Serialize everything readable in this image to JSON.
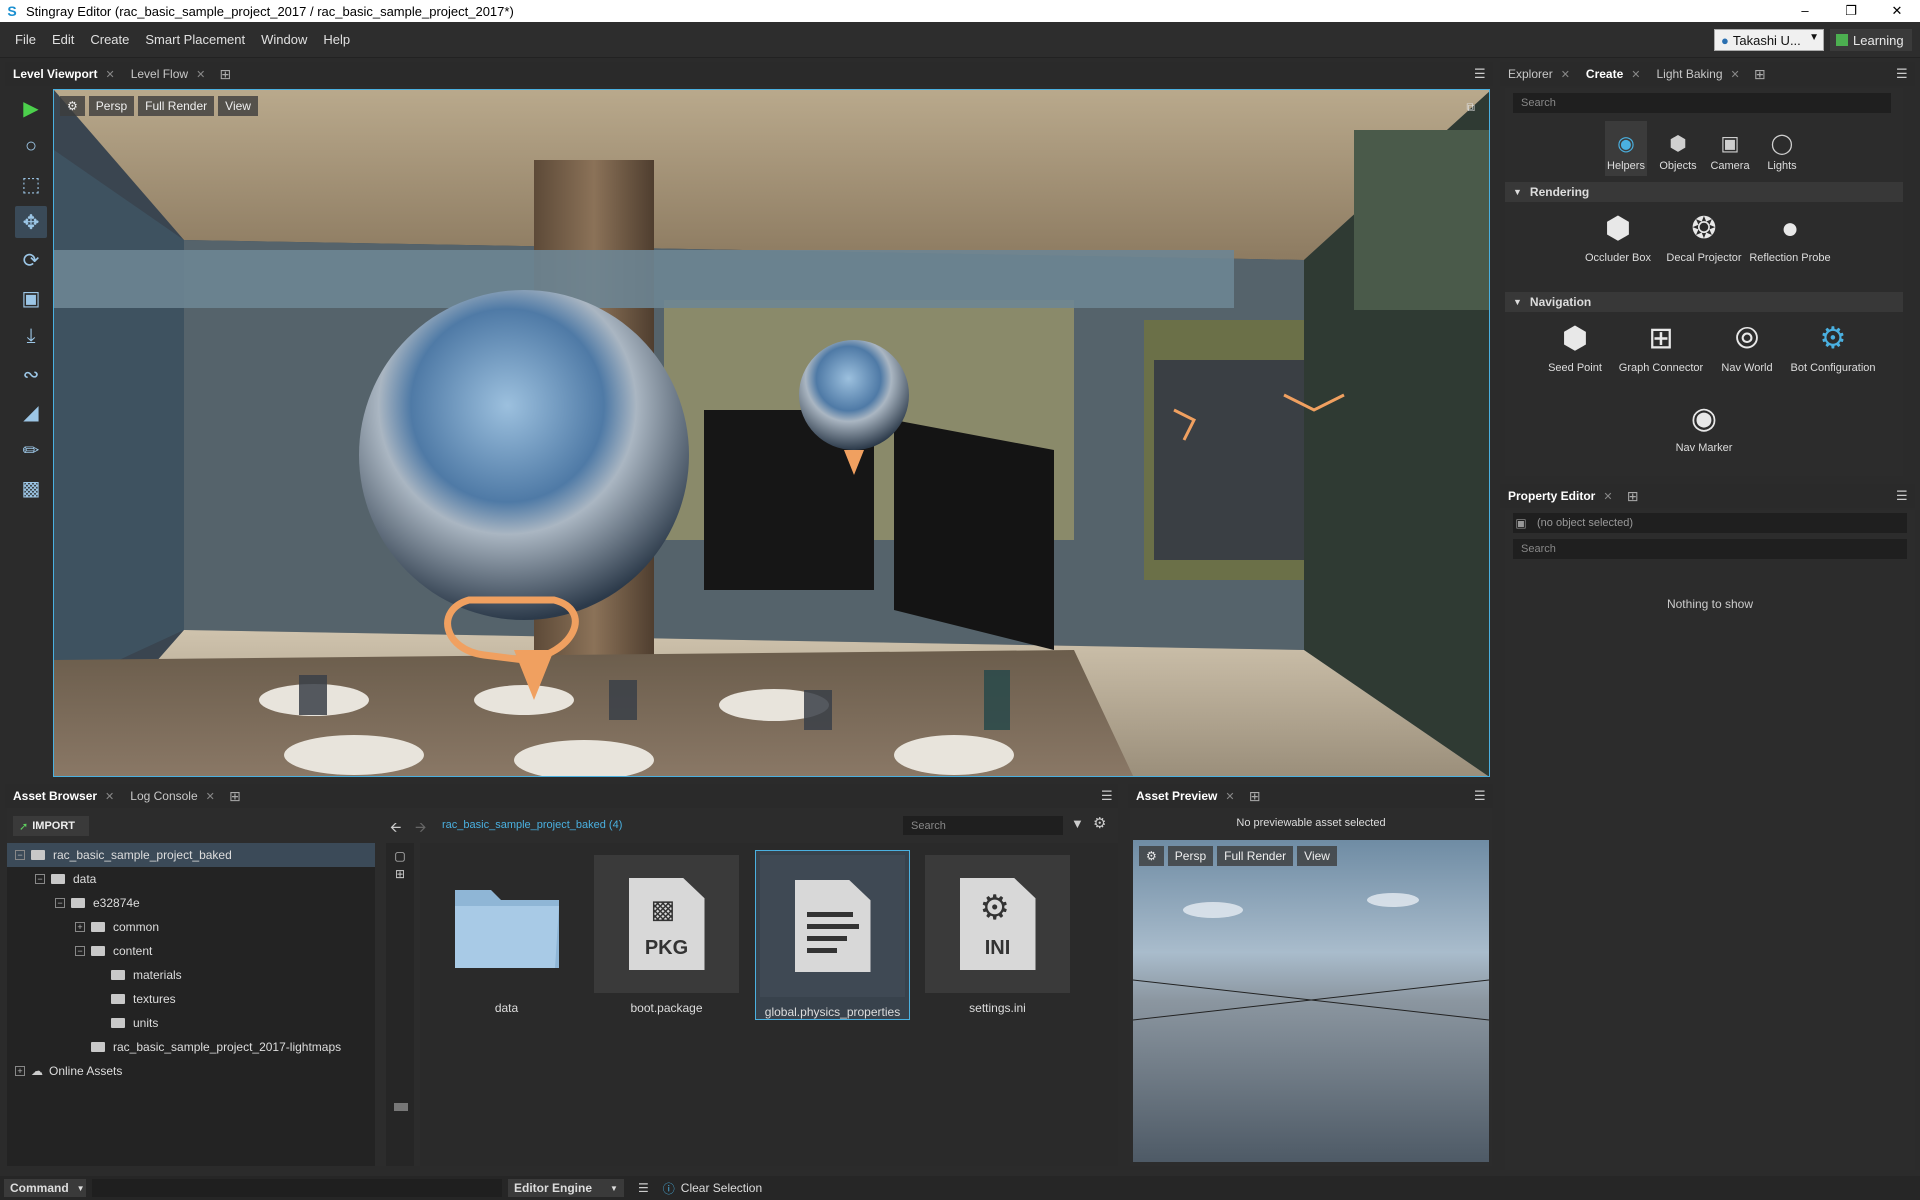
{
  "window": {
    "title": "Stingray Editor (rac_basic_sample_project_2017 / rac_basic_sample_project_2017*)",
    "app_icon": "stingray-logo-icon"
  },
  "menu": [
    "File",
    "Edit",
    "Create",
    "Smart Placement",
    "Window",
    "Help"
  ],
  "user": {
    "name": "Takashi U...",
    "learning_label": "Learning"
  },
  "viewport_tabs": {
    "tabs": [
      "Level Viewport",
      "Level Flow"
    ],
    "active": 0
  },
  "viewport": {
    "buttons": [
      "Persp",
      "Full Render",
      "View"
    ]
  },
  "right_tabs": {
    "tabs": [
      "Explorer",
      "Create",
      "Light Baking"
    ],
    "active": 1
  },
  "create_panel": {
    "search_placeholder": "Search",
    "categories": [
      "Helpers",
      "Objects",
      "Camera",
      "Lights"
    ],
    "selected_category": 0,
    "rendering": {
      "header": "Rendering",
      "items": [
        "Occluder Box",
        "Decal Projector",
        "Reflection Probe"
      ]
    },
    "navigation": {
      "header": "Navigation",
      "items": [
        "Seed Point",
        "Graph Connector",
        "Nav World",
        "Bot Configuration",
        "Nav Marker"
      ]
    }
  },
  "property_editor": {
    "tab": "Property Editor",
    "no_selection": "(no object selected)",
    "search_placeholder": "Search",
    "empty": "Nothing to show"
  },
  "bottom_tabs": {
    "tabs": [
      "Asset Browser",
      "Log Console"
    ],
    "active": 0
  },
  "asset_browser": {
    "import_label": "IMPORT",
    "breadcrumb": "rac_basic_sample_project_baked (4)",
    "search_placeholder": "Search",
    "tree": [
      {
        "label": "rac_basic_sample_project_baked",
        "depth": 0,
        "expander": "−",
        "selected": true
      },
      {
        "label": "data",
        "depth": 1,
        "expander": "−"
      },
      {
        "label": "e32874e",
        "depth": 2,
        "expander": "−"
      },
      {
        "label": "common",
        "depth": 3,
        "expander": "+"
      },
      {
        "label": "content",
        "depth": 3,
        "expander": "−"
      },
      {
        "label": "materials",
        "depth": 4,
        "expander": ""
      },
      {
        "label": "textures",
        "depth": 4,
        "expander": ""
      },
      {
        "label": "units",
        "depth": 4,
        "expander": ""
      },
      {
        "label": "rac_basic_sample_project_2017-lightmaps",
        "depth": 3,
        "expander": ""
      },
      {
        "label": "Online Assets",
        "depth": 0,
        "expander": "+"
      }
    ],
    "assets": [
      {
        "label": "data",
        "kind": "folder"
      },
      {
        "label": "boot.package",
        "kind": "pkg",
        "badge": "PKG"
      },
      {
        "label": "global.physics_properties",
        "kind": "doc",
        "selected": true
      },
      {
        "label": "settings.ini",
        "kind": "ini",
        "badge": "INI"
      }
    ]
  },
  "asset_preview": {
    "tab": "Asset Preview",
    "message": "No previewable asset selected",
    "buttons": [
      "Persp",
      "Full Render",
      "View"
    ]
  },
  "status": {
    "command_label": "Command",
    "engine_label": "Editor Engine",
    "message": "Clear Selection"
  }
}
